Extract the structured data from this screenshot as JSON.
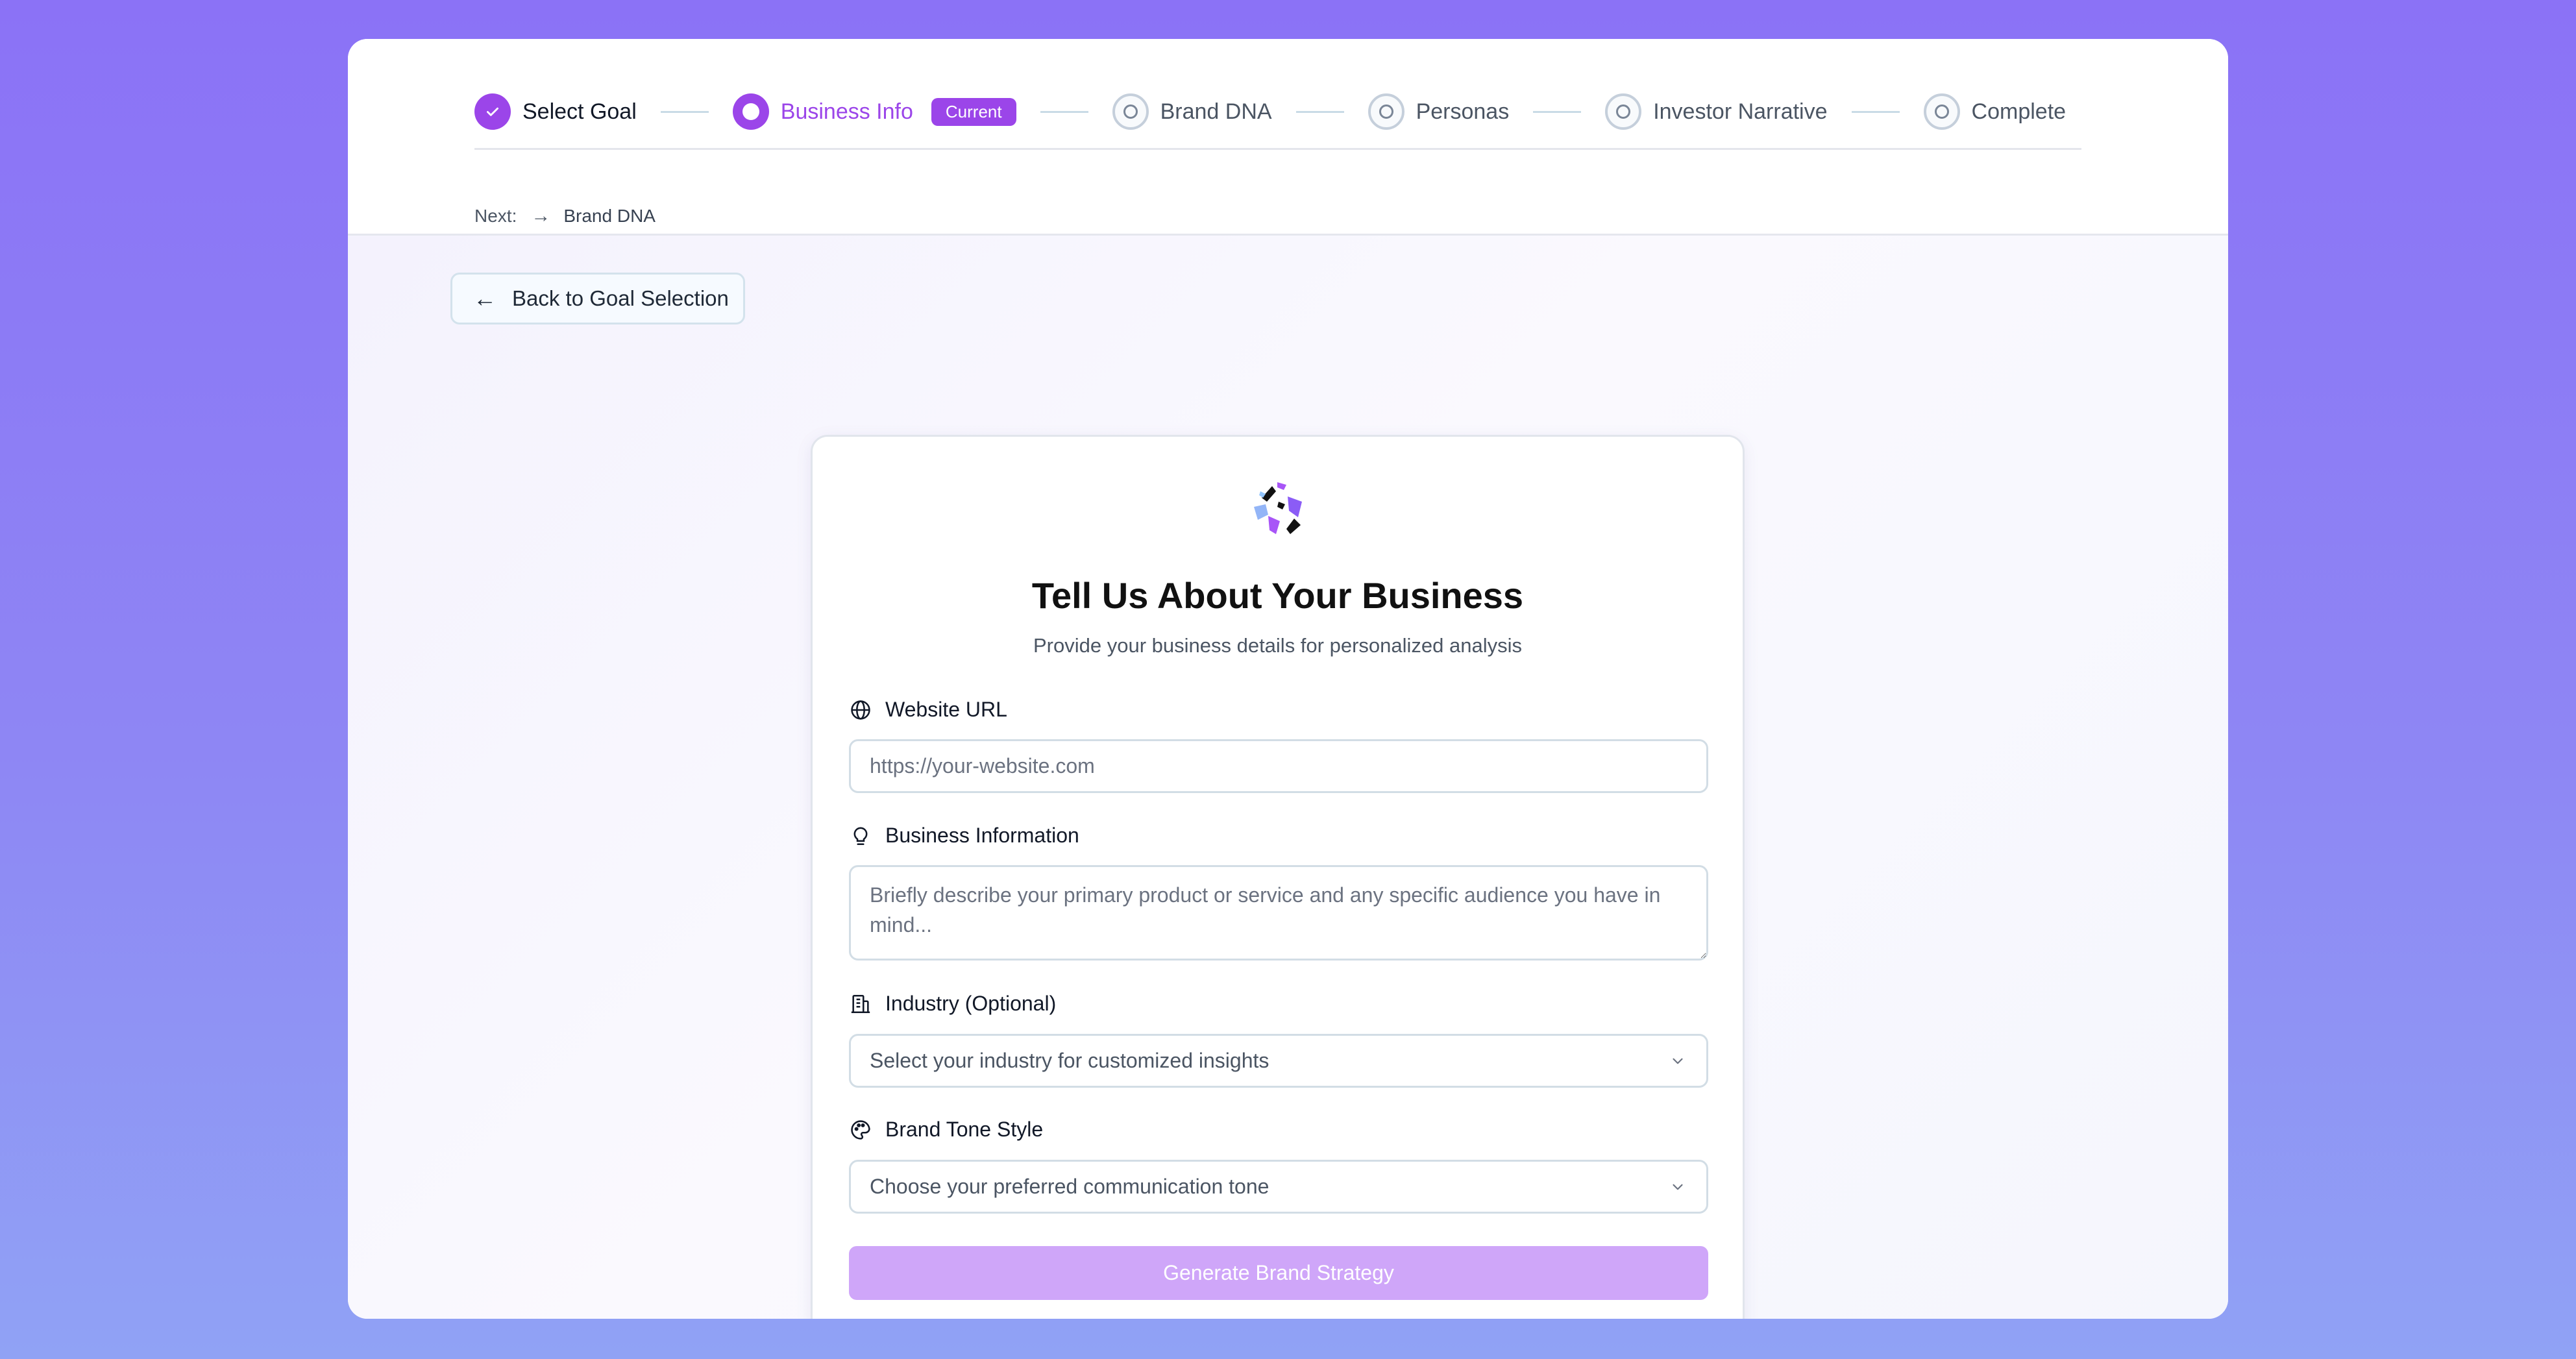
{
  "stepper": {
    "steps": [
      {
        "label": "Select Goal",
        "state": "done"
      },
      {
        "label": "Business Info",
        "state": "current",
        "badge": "Current"
      },
      {
        "label": "Brand DNA",
        "state": "pending"
      },
      {
        "label": "Personas",
        "state": "pending"
      },
      {
        "label": "Investor Narrative",
        "state": "pending"
      },
      {
        "label": "Complete",
        "state": "pending"
      }
    ],
    "next_label": "Next:",
    "next_value": "Brand DNA"
  },
  "back_button": {
    "label": "Back to Goal Selection"
  },
  "form": {
    "title": "Tell Us About Your Business",
    "subtitle": "Provide your business details for personalized analysis",
    "website": {
      "label": "Website URL",
      "placeholder": "https://your-website.com",
      "icon": "globe-icon"
    },
    "business_info": {
      "label": "Business Information",
      "placeholder": "Briefly describe your primary product or service and any specific audience you have in mind...",
      "icon": "lightbulb-icon"
    },
    "industry": {
      "label": "Industry (Optional)",
      "placeholder": "Select your industry for customized insights",
      "icon": "building-icon"
    },
    "brand_tone": {
      "label": "Brand Tone Style",
      "placeholder": "Choose your preferred communication tone",
      "icon": "palette-icon"
    },
    "submit_label": "Generate Brand Strategy"
  },
  "colors": {
    "accent": "#9b45e9",
    "button_disabled": "#cfa6f9",
    "background_top": "#8b72f6",
    "background_bottom": "#90a2f5"
  }
}
